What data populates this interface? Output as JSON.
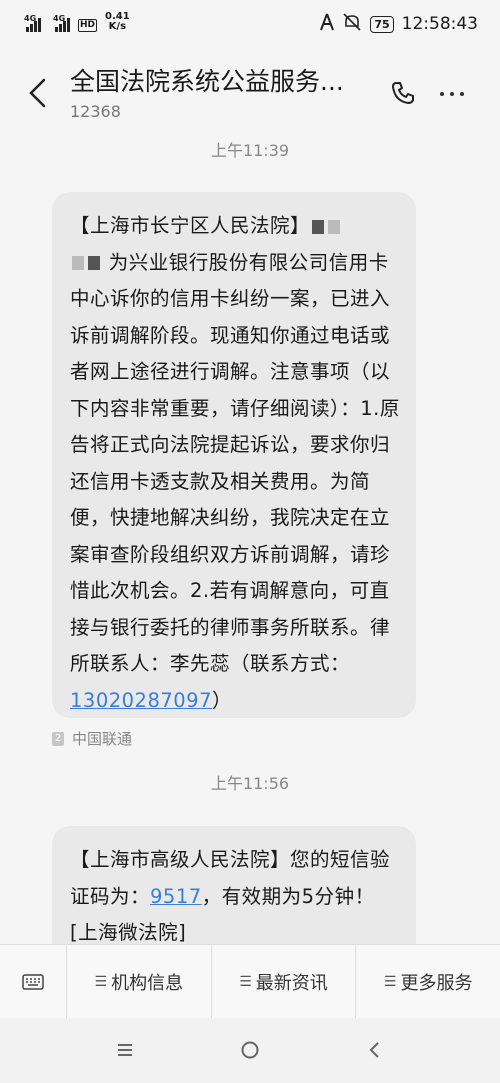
{
  "status_bar": {
    "net1": "4G",
    "net2": "4G",
    "hd_label": "HD",
    "speed_value": "0.41",
    "speed_unit": "K/s",
    "battery": "75",
    "time": "12:58:43"
  },
  "header": {
    "title": "全国法院系统公益服务...",
    "number": "12368"
  },
  "messages": [
    {
      "timestamp": "上午11:39",
      "part1": "【上海市长宁区人民法院】",
      "part2": "为兴业银行股份有限公司信用卡中心诉你的信用卡纠纷一案，已进入诉前调解阶段。现通知你通过电话或者网上途径进行调解。注意事项（以下内容非常重要，请仔细阅读）：1.原告将正式向法院提起诉讼，要求你归还信用卡透支款及相关费用。为简便，快捷地解决纠纷，我院决定在立案审查阶段组织双方诉前调解，请珍惜此次机会。2.若有调解意向，可直接与银行委托的律师事务所联系。律所联系人：李先蕊（联系方式：",
      "phone": "13020287097",
      "part3": "）",
      "carrier": "中国联通"
    },
    {
      "timestamp": "上午11:56",
      "part1": "【上海市高级人民法院】您的短信验证码为：",
      "code": "9517",
      "part2": "，有效期为5分钟！[上海微法院]"
    }
  ],
  "menu": {
    "items": [
      "机构信息",
      "最新资讯",
      "更多服务"
    ]
  },
  "icons": {
    "back": "chevron-left-icon",
    "call": "phone-icon",
    "more": "more-dots-icon",
    "keyboard": "keyboard-icon",
    "nav_menu": "menu-icon",
    "nav_home": "home-icon",
    "nav_back": "back-icon"
  }
}
